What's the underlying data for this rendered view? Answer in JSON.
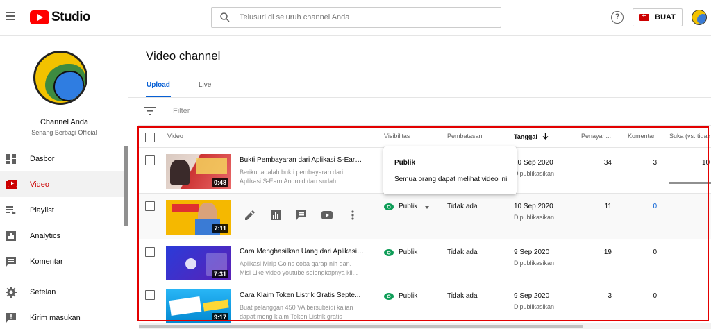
{
  "header": {
    "logo_text": "Studio",
    "search_placeholder": "Telusuri di seluruh channel Anda",
    "help_glyph": "?",
    "create_label": "BUAT"
  },
  "sidebar": {
    "channel_name": "Channel Anda",
    "channel_subtitle": "Senang Berbagi Official",
    "items": [
      {
        "label": "Dasbor",
        "icon": "dashboard-icon"
      },
      {
        "label": "Video",
        "icon": "video-icon",
        "active": true
      },
      {
        "label": "Playlist",
        "icon": "playlist-icon"
      },
      {
        "label": "Analytics",
        "icon": "analytics-icon"
      },
      {
        "label": "Komentar",
        "icon": "comment-icon"
      },
      {
        "label": "Setelan",
        "icon": "gear-icon"
      },
      {
        "label": "Kirim masukan",
        "icon": "feedback-icon"
      }
    ]
  },
  "main": {
    "title": "Video channel",
    "tabs": [
      {
        "label": "Upload",
        "active": true
      },
      {
        "label": "Live"
      }
    ],
    "filter_label": "Filter",
    "columns": {
      "video": "Video",
      "visibility": "Visibilitas",
      "restrictions": "Pembatasan",
      "date": "Tanggal",
      "views": "Penayan...",
      "comments": "Komentar",
      "likes": "Suka (vs. tidak"
    },
    "tooltip": {
      "title": "Publik",
      "body": "Semua orang dapat melihat video ini"
    },
    "rows": [
      {
        "title": "Bukti Pembayaran dari Aplikasi S-Earn ...",
        "desc1": "Berikut adalah bukti pembayaran dari",
        "desc2": "Aplikasi S-Earn Android dan sudah...",
        "duration": "0:48",
        "visibility": "Publik",
        "restriction": "",
        "date": "10 Sep 2020",
        "date_status": "Dipublikasikan",
        "views": "34",
        "comments": "3",
        "likes": "10"
      },
      {
        "title": "",
        "desc1": "",
        "desc2": "",
        "duration": "7:11",
        "visibility": "Publik",
        "restriction": "Tidak ada",
        "date": "10 Sep 2020",
        "date_status": "Dipublikasikan",
        "views": "11",
        "comments": "0",
        "likes": ""
      },
      {
        "title": "Cara Menghasilkan Uang dari Aplikasi ...",
        "desc1": "Aplikasi Mirip Goins coba garap nih gan.",
        "desc2": "Misi Like video youtube selengkapnya kli...",
        "duration": "7:31",
        "visibility": "Publik",
        "restriction": "Tidak ada",
        "date": "9 Sep 2020",
        "date_status": "Dipublikasikan",
        "views": "19",
        "comments": "0",
        "likes": ""
      },
      {
        "title": "Cara Klaim Token Listrik Gratis Septe...",
        "desc1": "Buat pelanggan 450 VA bersubsidi kalian",
        "desc2": "dapat meng klaim Token Listrik gratis",
        "duration": "9:17",
        "visibility": "Publik",
        "restriction": "Tidak ada",
        "date": "9 Sep 2020",
        "date_status": "Dipublikasikan",
        "views": "3",
        "comments": "0",
        "likes": ""
      }
    ]
  },
  "colors": {
    "accent_blue": "#065fd4",
    "active_red": "#cc0000",
    "highlight_outline": "#e30000",
    "public_green": "#0f9d58"
  }
}
